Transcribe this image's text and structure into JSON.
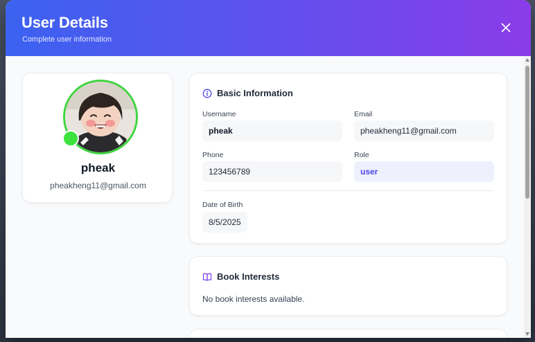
{
  "header": {
    "title": "User Details",
    "subtitle": "Complete user information"
  },
  "profile": {
    "name": "pheak",
    "email": "pheakheng11@gmail.com",
    "online": true
  },
  "basic_info": {
    "title": "Basic Information",
    "fields": {
      "username": {
        "label": "Username",
        "value": "pheak"
      },
      "email": {
        "label": "Email",
        "value": "pheakheng11@gmail.com"
      },
      "phone": {
        "label": "Phone",
        "value": "123456789"
      },
      "role": {
        "label": "Role",
        "value": "user"
      },
      "dob": {
        "label": "Date of Birth",
        "value": "8/5/2025"
      }
    }
  },
  "book_interests": {
    "title": "Book Interests",
    "empty_text": "No book interests available."
  },
  "colors": {
    "header_start": "#3b62f0",
    "header_end": "#8a3ce8",
    "online": "#3de23d",
    "accent": "#4f46e5"
  },
  "icons": [
    "close-icon",
    "info-icon",
    "book-icon"
  ]
}
